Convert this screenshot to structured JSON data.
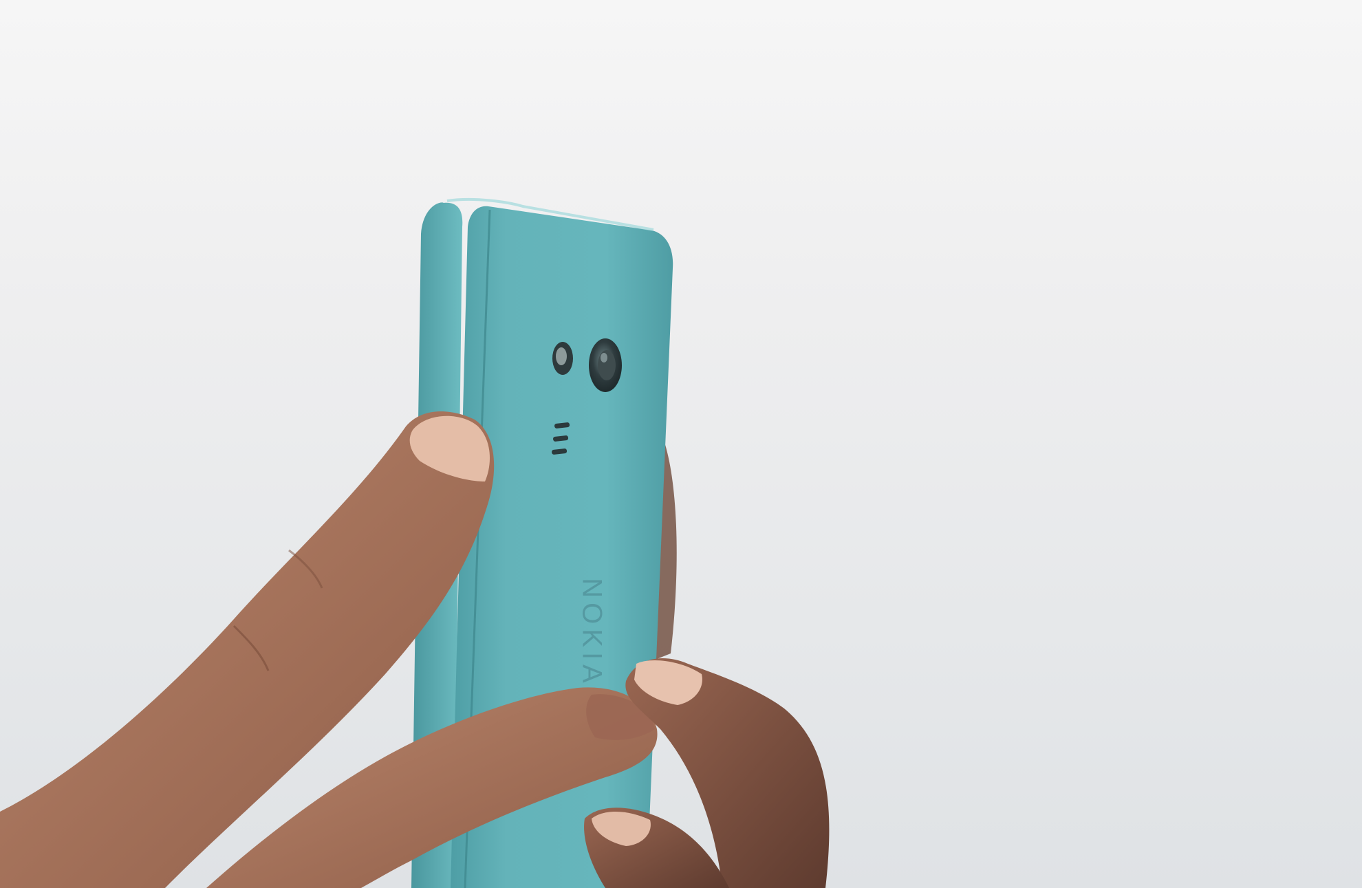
{
  "photo": {
    "subject": "hand-holding-feature-phone",
    "brand_text": "NOKIA",
    "colors": {
      "background": "#ececec",
      "phone_body": "#62b2b8",
      "phone_shadow": "#4b9aa1",
      "phone_highlight": "#8fd0d4",
      "skin": "#a8735c",
      "skin_shadow": "#7d5240",
      "nail": "#e7c2ae",
      "lens": "#2f3b3d"
    }
  }
}
